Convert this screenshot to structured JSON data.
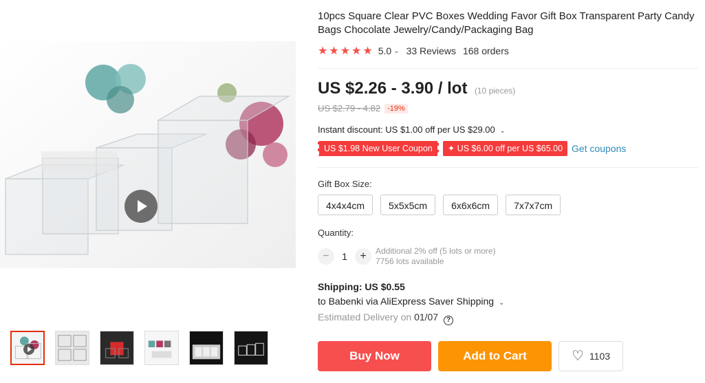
{
  "product": {
    "title": "10pcs Square Clear PVC Boxes Wedding Favor Gift Box Transparent Party Candy Bags Chocolate Jewelry/Candy/Packaging Bag",
    "rating": "5.0",
    "reviews": "33 Reviews",
    "orders": "168 orders",
    "stars": 5
  },
  "price": {
    "current": "US $2.26 - 3.90 / lot",
    "pieces": "(10 pieces)",
    "original": "US $2.79 - 4.82",
    "discount": "-19%"
  },
  "instant_discount": "Instant discount: US $1.00 off per US $29.00",
  "coupons": {
    "new_user": "US $1.98 New User Coupon",
    "store": "✦ US $6.00 off per US $65.00",
    "link": "Get coupons"
  },
  "sku": {
    "label": "Gift Box Size:",
    "options": [
      "4x4x4cm",
      "5x5x5cm",
      "6x6x6cm",
      "7x7x7cm"
    ]
  },
  "quantity": {
    "label": "Quantity:",
    "minus": "−",
    "plus": "+",
    "value": "1",
    "note_discount": "Additional 2% off (5 lots or more)",
    "note_available": "7756 lots available"
  },
  "shipping": {
    "title": "Shipping: US $0.55",
    "method": "to Babenki via AliExpress Saver Shipping",
    "delivery_label": "Estimated Delivery on ",
    "delivery_date": "01/07"
  },
  "actions": {
    "buy_now": "Buy Now",
    "add_to_cart": "Add to Cart",
    "wishlist_count": "1103"
  },
  "colors": {
    "buy_now": "#f74e4e",
    "add_to_cart": "#fc9404",
    "coupon": "#f53b3b",
    "link": "#2f8cb8",
    "star": "#f55047",
    "active_thumb_border": "#e62e04"
  },
  "icons": {
    "play": "play-icon",
    "star": "star-icon",
    "heart": "heart-icon",
    "help": "question-circle-icon",
    "chevron": "chevron-down-icon"
  }
}
